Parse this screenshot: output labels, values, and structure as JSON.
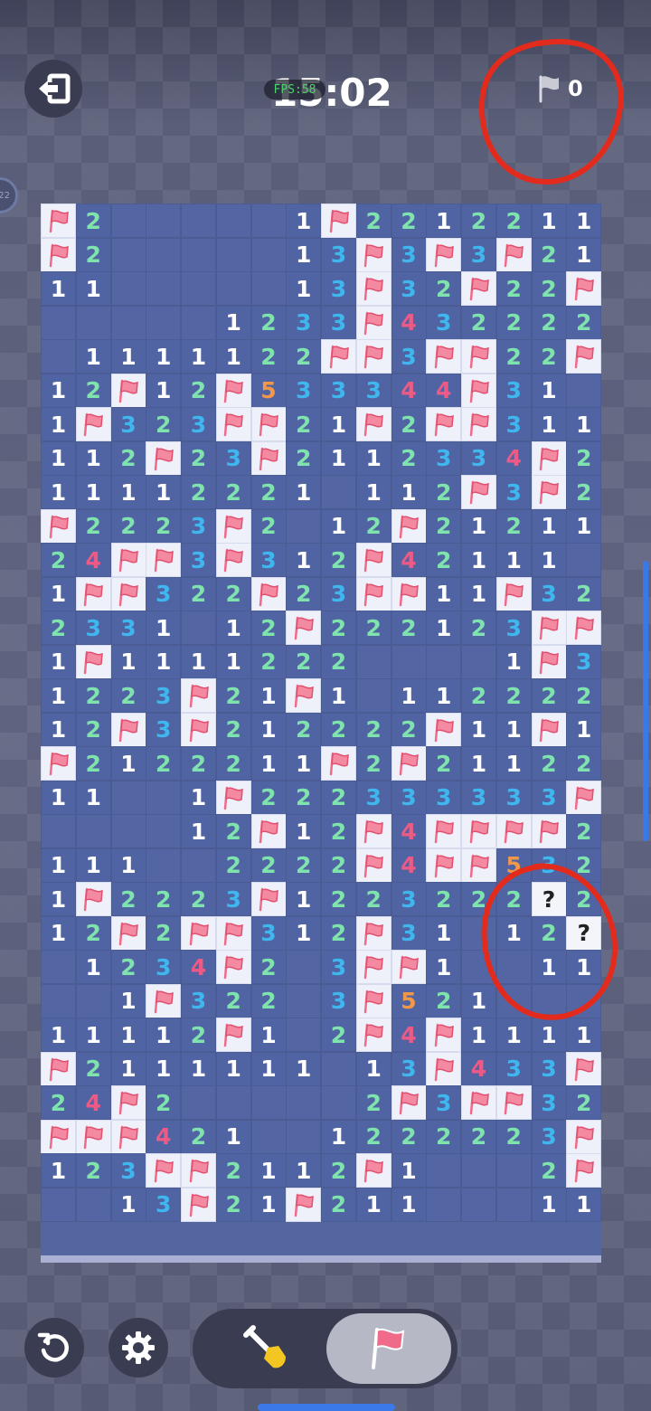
{
  "header": {
    "timer": "15:02",
    "fps_label": "FPS:58",
    "flag_count": "0",
    "side_badge": "22"
  },
  "board": {
    "rows": 31,
    "cols": 16,
    "cells": [
      "F2.....1F2212211F",
      "F2.....13F3F3F21",
      "11.....13F32F22F",
      ".....1233F4322221",
      ".1111122FF3FF22F1.",
      "12F12F533344F31.",
      "1F323FF21F2FF311",
      "112F23F211233 4F2",
      "1111222 1.112F3F2",
      "F2223F2.12F2121 1",
      "24FF3F312F42111.",
      "1FF322F23FF11F32",
      "2331.12F2221 23FF",
      "1F111122 2....1F32",
      "1223F21F1.11222 21",
      "12F3F21222 2F11F1",
      "F2122211F2F21122",
      "11..1F2223333 33F",
      "....12F12F4FFFF2",
      "111..2222F4FF532",
      "1F2223F12232 22?2",
      "12F2FF312F31.12?",
      ".1234F2.3FF1..11",
      "..1F322.3F521...",
      "11112F1.2F4F1111",
      "F2111111.13F433F1",
      "24F2.....2F3FF32",
      "FFF421..1222223F",
      "123FF2112F1...2F",
      "..13F21F211...11"
    ],
    "number_colors": {
      "1": "#ffffff",
      "2": "#7fe3ad",
      "3": "#3fb6ee",
      "4": "#ee5a86",
      "5": "#f0974a"
    }
  },
  "icons": {
    "exit": "exit-icon",
    "flag": "flag-icon",
    "restart": "restart-icon",
    "settings": "gear-icon",
    "dig": "shovel-icon",
    "flag_mode": "flag-mode-icon"
  },
  "colors": {
    "board_bg": "#5466a0",
    "flag_red": "#f06a8a",
    "annotation_red": "#e32b1d",
    "active_mode": "#b7b8c6"
  }
}
